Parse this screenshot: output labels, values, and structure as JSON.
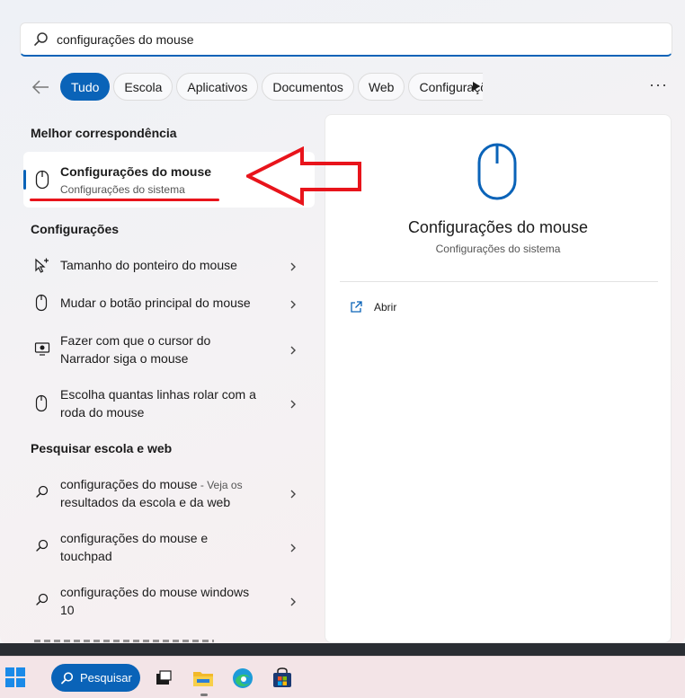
{
  "search": {
    "value": "configurações do mouse",
    "icon": "search-icon"
  },
  "filters": {
    "back_icon": "arrow-left-icon",
    "chips": [
      "Tudo",
      "Escola",
      "Aplicativos",
      "Documentos",
      "Web",
      "Configurações"
    ],
    "active_chip": "Tudo",
    "more_label": "···"
  },
  "best_match": {
    "section_title": "Melhor correspondência",
    "title": "Configurações do mouse",
    "subtitle": "Configurações do sistema",
    "icon": "mouse-icon"
  },
  "settings": {
    "section_title": "Configurações",
    "items": [
      {
        "icon": "pointer-icon",
        "line1": "Tamanho do ponteiro do mouse",
        "line2": ""
      },
      {
        "icon": "mouse-icon",
        "line1": "Mudar o botão principal do mouse",
        "line2": ""
      },
      {
        "icon": "narrator-icon",
        "line1": "Fazer com que o cursor do",
        "line2": "Narrador siga o mouse"
      },
      {
        "icon": "mouse-icon",
        "line1": "Escolha quantas linhas rolar com a",
        "line2": "roda do mouse"
      }
    ]
  },
  "web": {
    "section_title": "Pesquisar escola e web",
    "items": [
      {
        "line1": "configurações do mouse",
        "hint": " - Veja os",
        "line2": "resultados da escola e da web"
      },
      {
        "line1": "configurações do mouse e",
        "hint": "",
        "line2": "touchpad"
      },
      {
        "line1": "configurações do mouse windows",
        "hint": "",
        "line2": "10"
      }
    ]
  },
  "preview": {
    "title": "Configurações do mouse",
    "subtitle": "Configurações do sistema",
    "open_label": "Abrir"
  },
  "taskbar": {
    "search_label": "Pesquisar",
    "icons": [
      "windows-start-icon",
      "task-view-icon",
      "file-explorer-icon",
      "edge-icon",
      "store-icon"
    ]
  },
  "colors": {
    "accent": "#0a63b8",
    "annotation": "#e8141b"
  }
}
